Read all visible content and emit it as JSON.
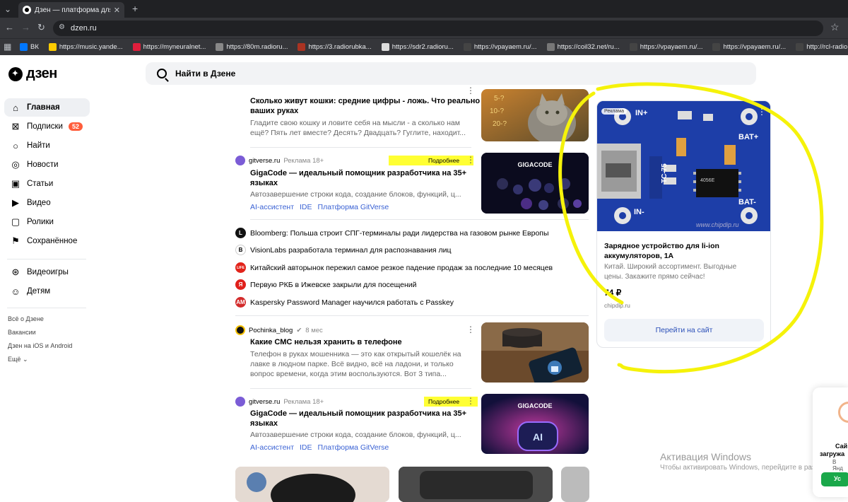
{
  "browser": {
    "tab_title": "Дзен — платформа для прос",
    "url": "dzen.ru",
    "bookmarks": [
      {
        "label": "ВК",
        "color": "#0077ff"
      },
      {
        "label": "https://music.yande...",
        "color": "#ffcc00"
      },
      {
        "label": "https://myneuralnet...",
        "color": "#e01e3c"
      },
      {
        "label": "https://80m.radioru...",
        "color": "#888888"
      },
      {
        "label": "https://3.radiorubka...",
        "color": "#aa3322"
      },
      {
        "label": "https://sdr2.radioru...",
        "color": "#dddddd"
      },
      {
        "label": "https://vpayaem.ru/...",
        "color": "#444444"
      },
      {
        "label": "https://coil32.net/ru...",
        "color": "#777777"
      },
      {
        "label": "https://vpayaem.ru/...",
        "color": "#444444"
      },
      {
        "label": "https://vpayaem.ru/...",
        "color": "#444444"
      },
      {
        "label": "http://rcl-radio.ru/?...",
        "color": "#444444"
      }
    ]
  },
  "header": {
    "logo": "дзен",
    "search_placeholder": "Найти в Дзене"
  },
  "sidebar": {
    "items": [
      {
        "label": "Главная",
        "icon": "home-icon",
        "glyph": "⌂",
        "active": true
      },
      {
        "label": "Подписки",
        "icon": "subscriptions-icon",
        "glyph": "⊠",
        "badge": "52"
      },
      {
        "label": "Найти",
        "icon": "search-icon",
        "glyph": "○"
      },
      {
        "label": "Новости",
        "icon": "news-icon",
        "glyph": "◎"
      },
      {
        "label": "Статьи",
        "icon": "articles-icon",
        "glyph": "▣"
      },
      {
        "label": "Видео",
        "icon": "video-icon",
        "glyph": "▶"
      },
      {
        "label": "Ролики",
        "icon": "clips-icon",
        "glyph": "▢"
      },
      {
        "label": "Сохранённое",
        "icon": "bookmark-icon",
        "glyph": "⚑"
      },
      {
        "label": "Видеоигры",
        "icon": "gamepad-icon",
        "glyph": "⊛"
      },
      {
        "label": "Детям",
        "icon": "kids-icon",
        "glyph": "☺"
      }
    ],
    "footer": [
      "Всё о Дзене",
      "Вакансии",
      "Дзен на iOS и Android",
      "Ещё"
    ]
  },
  "feed": {
    "card1": {
      "title_lines": [
        "Сколько живут кошки: средние цифры - ложь. Что реально в",
        "ваших руках"
      ],
      "desc_lines": [
        "Гладите свою кошку и ловите себя на мысли - а сколько нам",
        "ещё? Пять лет вместе? Десять? Двадцать? Гуглите, находит..."
      ]
    },
    "ad1": {
      "source": "gitverse.ru",
      "label": "Реклама 18+",
      "more": "Подробнее",
      "title_lines": [
        "GigaCode — идеальный помощник разработчика на 35+",
        "языках"
      ],
      "desc": "Автозавершение строки кода, создание блоков, функций, ц...",
      "tags": [
        "AI-ассистент",
        "IDE",
        "Платформа GitVerse"
      ],
      "thumb_text": "GIGACODE"
    },
    "news": [
      {
        "text": "Bloomberg: Польша строит СПГ-терминалы ради лидерства на газовом рынке Европы",
        "icon": "L",
        "color": "#111111"
      },
      {
        "text": "VisionLabs разработала терминал для распознавания лиц",
        "icon": "B",
        "color": "#ffffff"
      },
      {
        "text": "Китайский авторынок пережил самое резкое падение продаж за последние 10 месяцев",
        "icon": "LIFE",
        "color": "#e2231a"
      },
      {
        "text": "Первую РКБ в Ижевске закрыли для посещений",
        "icon": "Я",
        "color": "#e0201b"
      },
      {
        "text": "Kaspersky Password Manager научился работать с Passkey",
        "icon": "AM",
        "color": "#d32b2b"
      }
    ],
    "card2": {
      "source": "Pochinka_blog",
      "age": "8 мес",
      "title": "Какие СМС нельзя хранить в телефоне",
      "desc_lines": [
        "Телефон в руках мошенника — это как открытый кошелёк на",
        "лавке в людном парке. Всё видно, всё на ладони, и только",
        "вопрос времени, когда этим воспользуются. Вот 3 типа..."
      ]
    },
    "ad2": {
      "source": "gitverse.ru",
      "label": "Реклама 18+",
      "more": "Подробнее",
      "title_lines": [
        "GigaCode — идеальный помощник разработчика на 35+",
        "языках"
      ],
      "desc": "Автозавершение строки кода, создание блоков, функций, ц...",
      "tags": [
        "AI-ассистент",
        "IDE",
        "Платформа GitVerse"
      ],
      "thumb_text": "GIGACODE"
    }
  },
  "ad_card": {
    "badge": "Реклама",
    "board_labels": [
      "IN+",
      "BAT+",
      "IN-",
      "BAT-",
      "TC-75",
      "4056E",
      "www.chipdip.ru"
    ],
    "title_lines": [
      "Зарядное устройство для li-ion",
      "аккумуляторов, 1А"
    ],
    "desc_lines": [
      "Китай. Широкий ассортимент. Выгодные",
      "цены. Закажите прямо сейчас!"
    ],
    "price": "74 ₽",
    "domain": "chipdip.ru",
    "button": "Перейти на сайт"
  },
  "windows_watermark": {
    "line1": "Активация Windows",
    "line2": "Чтобы активировать Windows, перейдите в раздел \"Пар"
  },
  "popup_partial": {
    "line1": "Сай",
    "line2": "загружа",
    "line3": "В Янд",
    "button": "Ус"
  }
}
